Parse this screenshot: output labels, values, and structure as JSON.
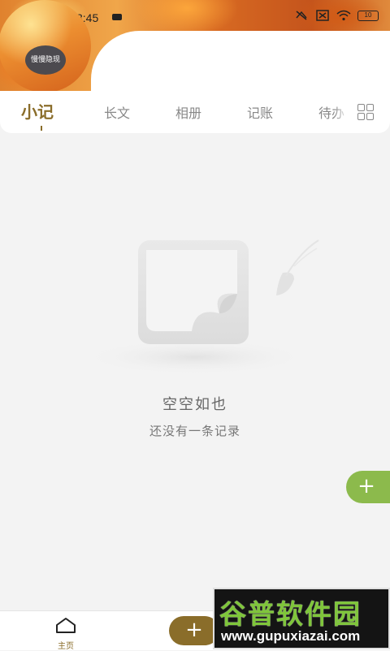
{
  "status_bar": {
    "time": "下午3:45",
    "battery": "10"
  },
  "profile": {
    "avatar_text": "慢慢隐现"
  },
  "tabs": [
    {
      "label": "小记",
      "active": true
    },
    {
      "label": "长文",
      "active": false
    },
    {
      "label": "相册",
      "active": false
    },
    {
      "label": "记账",
      "active": false
    },
    {
      "label": "待办",
      "active": false
    }
  ],
  "empty_state": {
    "title": "空空如也",
    "subtitle": "还没有一条记录"
  },
  "fab": {
    "symbol": "+"
  },
  "bottom_nav": {
    "home_label": "主页",
    "add_symbol": "+"
  },
  "watermark": {
    "title": "谷普软件园",
    "url": "www.gupuxiazai.com"
  },
  "colors": {
    "accent": "#8a6d2a",
    "fab_green": "#8cba4c"
  },
  "icons": [
    "home-icon",
    "grid-icon",
    "plus-icon",
    "wifi-icon",
    "battery-icon",
    "empty-box-icon"
  ]
}
